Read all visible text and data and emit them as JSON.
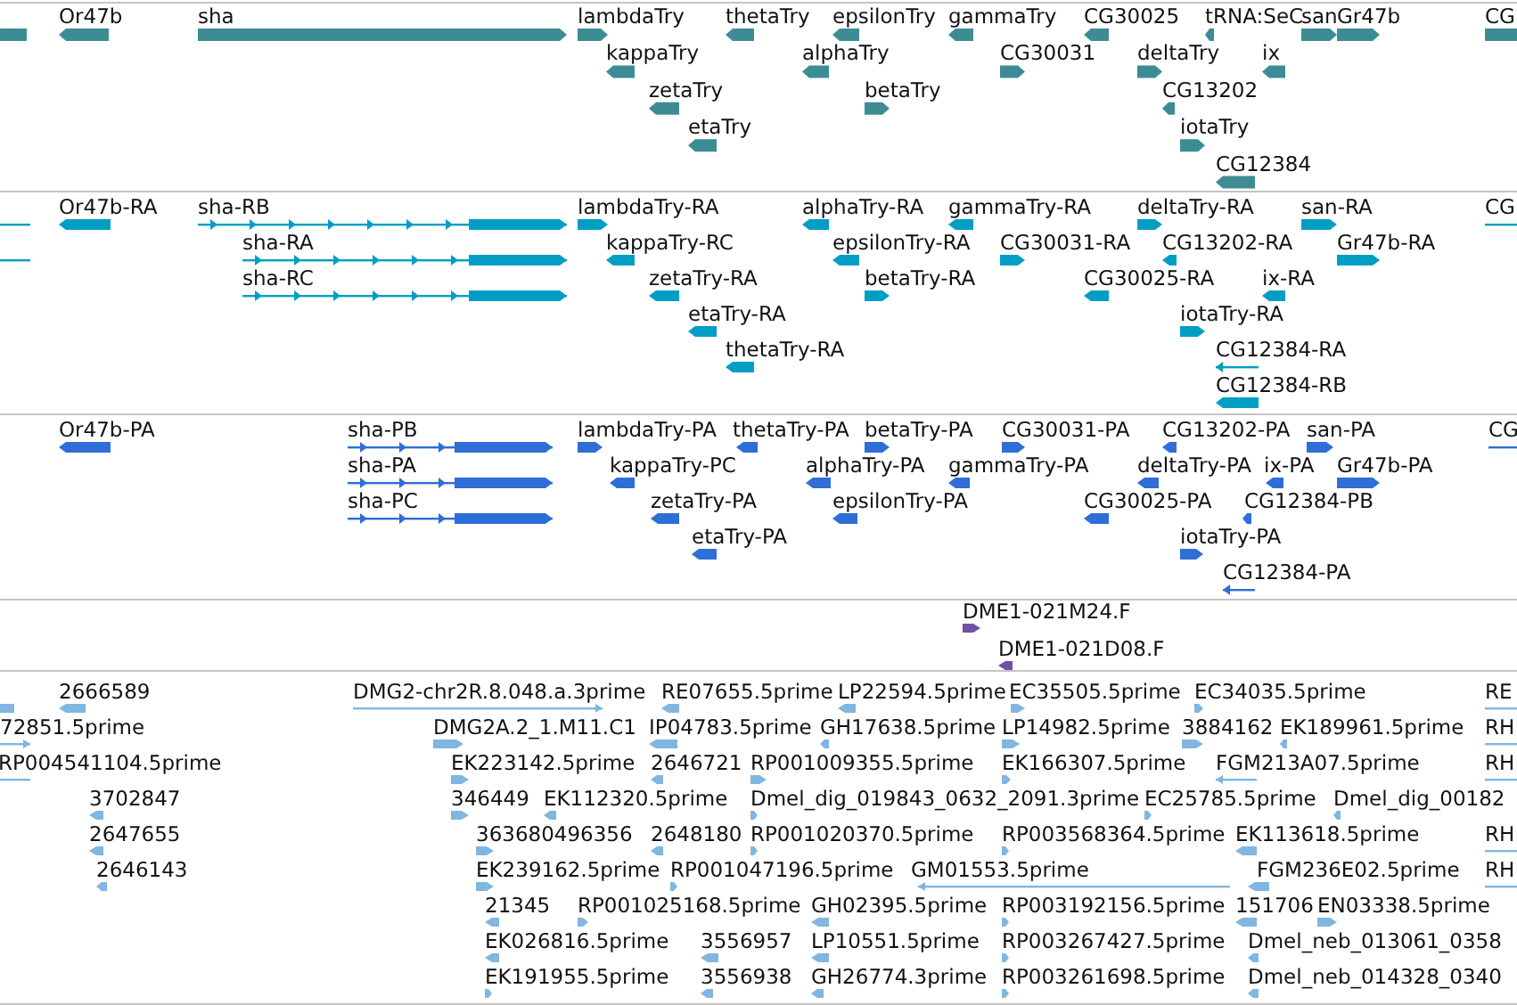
{
  "tracks": [
    {
      "kind": "gene",
      "features": [
        {
          "reverse": true
        },
        {
          "name": "Or47b",
          "reverse": true
        },
        {
          "name": "sha",
          "reverse": false
        },
        {
          "name": "lambdaTry",
          "reverse": false
        },
        {
          "name": "thetaTry",
          "reverse": true
        },
        {
          "name": "epsilonTry",
          "reverse": true
        },
        {
          "name": "gammaTry",
          "reverse": true
        },
        {
          "name": "CG30025",
          "reverse": true
        },
        {
          "name": "tRNA:SeC",
          "reverse": true
        },
        {
          "name": "san",
          "reverse": false
        },
        {
          "name": "Gr47b",
          "reverse": false
        },
        {
          "name": "CG",
          "reverse": false
        },
        {
          "name": "kappaTry",
          "reverse": true
        },
        {
          "name": "alphaTry",
          "reverse": true
        },
        {
          "name": "CG30031",
          "reverse": false
        },
        {
          "name": "deltaTry",
          "reverse": false
        },
        {
          "name": "ix",
          "reverse": true
        },
        {
          "name": "zetaTry",
          "reverse": true
        },
        {
          "name": "betaTry",
          "reverse": false
        },
        {
          "name": "CG13202",
          "reverse": true
        },
        {
          "name": "etaTry",
          "reverse": true
        },
        {
          "name": "iotaTry",
          "reverse": false
        },
        {
          "name": "CG12384",
          "reverse": true
        }
      ]
    },
    {
      "kind": "transcript",
      "features": [
        {
          "reverse": true
        },
        {
          "name": "Or47b-RA",
          "reverse": true
        },
        {
          "name": "sha-RB",
          "reverse": false
        },
        {
          "name": "lambdaTry-RA",
          "reverse": false
        },
        {
          "name": "alphaTry-RA",
          "reverse": true
        },
        {
          "name": "gammaTry-RA",
          "reverse": true
        },
        {
          "name": "deltaTry-RA",
          "reverse": false
        },
        {
          "name": "san-RA",
          "reverse": false
        },
        {
          "name": "CG",
          "reverse": false
        },
        {
          "reverse": true
        },
        {
          "name": "sha-RA",
          "reverse": false
        },
        {
          "name": "kappaTry-RC",
          "reverse": true
        },
        {
          "name": "epsilonTry-RA",
          "reverse": true
        },
        {
          "name": "CG30031-RA",
          "reverse": false
        },
        {
          "name": "CG13202-RA",
          "reverse": true
        },
        {
          "name": "Gr47b-RA",
          "reverse": false
        },
        {
          "name": "sha-RC",
          "reverse": false
        },
        {
          "name": "zetaTry-RA",
          "reverse": true
        },
        {
          "name": "betaTry-RA",
          "reverse": false
        },
        {
          "name": "CG30025-RA",
          "reverse": true
        },
        {
          "name": "ix-RA",
          "reverse": true
        },
        {
          "name": "etaTry-RA",
          "reverse": true
        },
        {
          "name": "iotaTry-RA",
          "reverse": false
        },
        {
          "name": "thetaTry-RA",
          "reverse": true
        },
        {
          "name": "CG12384-RA",
          "reverse": true
        },
        {
          "name": "CG12384-RB",
          "reverse": true
        }
      ]
    },
    {
      "kind": "protein",
      "features": [
        {
          "name": "Or47b-PA",
          "reverse": true
        },
        {
          "name": "sha-PB",
          "reverse": false
        },
        {
          "name": "lambdaTry-PA",
          "reverse": false
        },
        {
          "name": "thetaTry-PA",
          "reverse": true
        },
        {
          "name": "betaTry-PA",
          "reverse": false
        },
        {
          "name": "CG30031-PA",
          "reverse": false
        },
        {
          "name": "CG13202-PA",
          "reverse": true
        },
        {
          "name": "san-PA",
          "reverse": false
        },
        {
          "name": "CG",
          "reverse": false
        },
        {
          "name": "sha-PA",
          "reverse": false
        },
        {
          "name": "kappaTry-PC",
          "reverse": true
        },
        {
          "name": "alphaTry-PA",
          "reverse": true
        },
        {
          "name": "gammaTry-PA",
          "reverse": true
        },
        {
          "name": "deltaTry-PA",
          "reverse": true
        },
        {
          "name": "ix-PA",
          "reverse": true
        },
        {
          "name": "Gr47b-PA",
          "reverse": false
        },
        {
          "name": "sha-PC",
          "reverse": false
        },
        {
          "name": "zetaTry-PA",
          "reverse": true
        },
        {
          "name": "epsilonTry-PA",
          "reverse": true
        },
        {
          "name": "CG30025-PA",
          "reverse": true
        },
        {
          "name": "CG12384-PB",
          "reverse": true
        },
        {
          "name": "etaTry-PA",
          "reverse": true
        },
        {
          "name": "iotaTry-PA",
          "reverse": false
        },
        {
          "name": "CG12384-PA",
          "reverse": true
        }
      ]
    },
    {
      "kind": "clone",
      "features": [
        {
          "name": "DME1-021M24.F",
          "reverse": false
        },
        {
          "name": "DME1-021D08.F",
          "reverse": true
        }
      ]
    },
    {
      "kind": "est",
      "features": [
        {
          "reverse": true
        },
        {
          "name": "2666589",
          "reverse": true
        },
        {
          "name": "DMG2-chr2R.8.048.a.3prime",
          "reverse": false
        },
        {
          "name": "RE07655.5prime",
          "reverse": true
        },
        {
          "name": "LP22594.5prime",
          "reverse": true
        },
        {
          "name": "EC35505.5prime",
          "reverse": false
        },
        {
          "name": "EC34035.5prime",
          "reverse": false
        },
        {
          "name": "RE",
          "reverse": false
        },
        {
          "name": "72851.5prime",
          "reverse": false
        },
        {
          "name": "DMG2A.2_1.M11.C1",
          "reverse": false
        },
        {
          "name": "IP04783.5prime",
          "reverse": true
        },
        {
          "name": "GH17638.5prime",
          "reverse": true
        },
        {
          "name": "LP14982.5prime",
          "reverse": false
        },
        {
          "name": "3884162",
          "reverse": false
        },
        {
          "name": "EK189961.5prime",
          "reverse": true
        },
        {
          "name": "RH",
          "reverse": false
        },
        {
          "name": "RP004541104.5prime",
          "reverse": true
        },
        {
          "name": "EK223142.5prime",
          "reverse": false
        },
        {
          "name": "2646721",
          "reverse": true
        },
        {
          "name": "RP001009355.5prime",
          "reverse": false
        },
        {
          "name": "EK166307.5prime",
          "reverse": false
        },
        {
          "name": "FGM213A07.5prime",
          "reverse": true
        },
        {
          "name": "RH",
          "reverse": false
        },
        {
          "name": "3702847",
          "reverse": true
        },
        {
          "name": "346449",
          "reverse": false
        },
        {
          "name": "EK112320.5prime",
          "reverse": true
        },
        {
          "name": "Dmel_dig_019843_0632_2091.3prime",
          "reverse": false
        },
        {
          "name": "EC25785.5prime",
          "reverse": false
        },
        {
          "name": "Dmel_dig_00182",
          "reverse": true
        },
        {
          "name": "2647655",
          "reverse": true
        },
        {
          "name": "363680496356",
          "reverse": false
        },
        {
          "name": "2648180",
          "reverse": true
        },
        {
          "name": "RP001020370.5prime",
          "reverse": false
        },
        {
          "name": "RP003568364.5prime",
          "reverse": false
        },
        {
          "name": "EK113618.5prime",
          "reverse": true
        },
        {
          "name": "RH",
          "reverse": false
        },
        {
          "name": "2646143",
          "reverse": true
        },
        {
          "name": "EK239162.5prime",
          "reverse": false
        },
        {
          "name": "RP001047196.5prime",
          "reverse": false
        },
        {
          "name": "GM01553.5prime",
          "reverse": true
        },
        {
          "name": "FGM236E02.5prime",
          "reverse": true
        },
        {
          "name": "RH",
          "reverse": false
        },
        {
          "name": "21345",
          "reverse": true
        },
        {
          "name": "RP001025168.5prime",
          "reverse": false
        },
        {
          "name": "GH02395.5prime",
          "reverse": true
        },
        {
          "name": "RP003192156.5prime",
          "reverse": false
        },
        {
          "name": "151706",
          "reverse": true
        },
        {
          "name": "EN03338.5prime",
          "reverse": false
        },
        {
          "name": "EK026816.5prime",
          "reverse": true
        },
        {
          "name": "3556957",
          "reverse": true
        },
        {
          "name": "LP10551.5prime",
          "reverse": true
        },
        {
          "name": "RP003267427.5prime",
          "reverse": false
        },
        {
          "name": "Dmel_neb_013061_0358",
          "reverse": true
        },
        {
          "name": "EK191955.5prime",
          "reverse": false
        },
        {
          "name": "3556938",
          "reverse": true
        },
        {
          "name": "GH26774.3prime",
          "reverse": true
        },
        {
          "name": "RP003261698.5prime",
          "reverse": false
        },
        {
          "name": "Dmel_neb_014328_0340",
          "reverse": true
        }
      ]
    }
  ]
}
